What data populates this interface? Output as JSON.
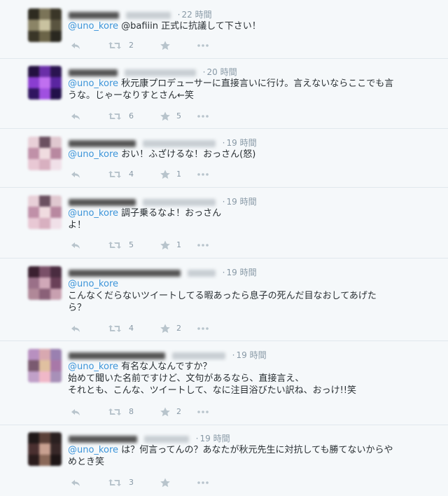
{
  "colors": {
    "mention": "#3b94d9",
    "meta": "#8899a6",
    "text": "#292f33",
    "divider": "#e1e8ed",
    "background": "#f5f8fa"
  },
  "icons": {
    "reply": "reply-icon",
    "retweet": "retweet-icon",
    "favorite": "star-icon",
    "more": "more-icon"
  },
  "tweets": [
    {
      "time": "22 時間",
      "mention": "@uno_kore",
      "body": " @bafiiin 正式に抗議して下さい！",
      "retweets": "2",
      "favorites": ""
    },
    {
      "time": "20 時間",
      "mention": "@uno_kore",
      "body": " 秋元康プロデューサーに直接言いに行け。言えないならここでも言\nうな。じゃーなりすとさん←笑",
      "retweets": "6",
      "favorites": "5"
    },
    {
      "time": "19 時間",
      "mention": "@uno_kore",
      "body": " おい！ふざけるな！おっさん(怒)",
      "retweets": "4",
      "favorites": "1"
    },
    {
      "time": "19 時間",
      "mention": "@uno_kore",
      "body": " 調子乗るなよ！おっさん\nよ！",
      "retweets": "5",
      "favorites": "1"
    },
    {
      "time": "19 時間",
      "mention": "@uno_kore",
      "body": "\nこんなくだらないツイートしてる暇あったら息子の死んだ目なおしてあげた\nら？",
      "retweets": "4",
      "favorites": "2"
    },
    {
      "time": "19 時間",
      "mention": "@uno_kore",
      "body": " 有名な人なんですか？\n始めて聞いた名前ですけど、文句があるなら、直接言え、\nそれとも、こんな、ツイートして、なに注目浴びたい訳ね、おっけ!!笑",
      "retweets": "8",
      "favorites": "2"
    },
    {
      "time": "19 時間",
      "mention": "@uno_kore",
      "body": " は？何言ってんの？あなたが秋元先生に対抗しても勝てないからや\nめとき笑",
      "retweets": "3",
      "favorites": ""
    }
  ]
}
